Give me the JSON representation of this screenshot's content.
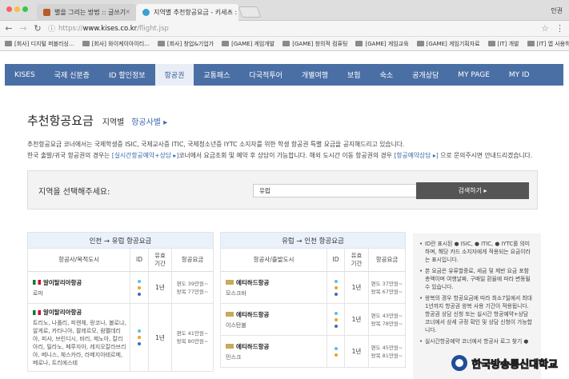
{
  "browser": {
    "tabs": [
      {
        "label": "별을 그리는 방법 :: 글쓰기",
        "close": "×"
      },
      {
        "label": "지역별 추천항공요금 - 키세스 : 학생",
        "close": "×"
      }
    ],
    "user": "인권",
    "url_prefix": "https://",
    "url_host": "www.kises.co.kr",
    "url_path": "/flight.jsp",
    "bookmarks": [
      "[회사] 디지털 퍼블리싱...",
      "[회사] 와이케이아이티...",
      "[회사] 창업&기업가",
      "[GAME] 게임개발",
      "[GAME] 창의적 컴퓨팅",
      "[GAME] 게임교육",
      "[GAME] 게임기획자료",
      "[IT] 개발",
      "[IT] 앱 사용하기"
    ]
  },
  "gnb": [
    "KISES",
    "국제 신분증",
    "ID 할인정보",
    "항공권",
    "교통패스",
    "다국적투어",
    "개별여행",
    "보험",
    "숙소",
    "공개상담",
    "MY PAGE",
    "MY ID"
  ],
  "gnb_active_index": 3,
  "page": {
    "title": "추천항공요금",
    "sub1": "지역별",
    "sub2": "항공사별 ▸",
    "desc_line1": "추천항공요금 코너에서는 국제학생증 ISIC, 국제교사증 ITIC, 국제청소년증 IYTC 소지자를 위한 학생 항공권 특별 요금을 공지해드리고 있습니다.",
    "desc_line2_a": "한국 출발/귀국 항공권의 경우는 ",
    "desc_line2_link1": "[실시간항공예약+상담 ▸]",
    "desc_line2_b": "코너에서 요금조회 및 예약 후 상담이 가능합니다. 해외 도시간 이동 항공권의 경우 ",
    "desc_line2_link2": "[항공예약상담 ▸]",
    "desc_line2_c": " 으로 문의주시면 안내드리겠습니다."
  },
  "region": {
    "label": "지역을 선택해주세요:",
    "selected": "유럽",
    "arrow": "▴▾",
    "search": "검색하기 ▸"
  },
  "left_panel": {
    "header": "인천 → 유럽 항공요금",
    "columns": [
      "항공사/목적도시",
      "ID",
      "유효\n기간",
      "항공요금"
    ],
    "rows": [
      {
        "airline": "알이탈리아항공",
        "city": "로마",
        "ids": [
          "#5bc0de",
          "#f0a020",
          "#3f6db3"
        ],
        "validity": "1년",
        "price1": "편도 39만원~",
        "price2": "왕복 77만원~"
      },
      {
        "airline": "알이탈리아항공",
        "city": "트리노, 나폴리, 피렌체, 랑코나, 볼로냐, 알게로, 카타니아, 팔레르모, 람펠데리아, 피사, 브린디시, 바리, 제노아, 칼리아리, 밀라노, 페루자아, 레지오칼라브리아, 베니스, 체스카라, 라메지아테르메, 베로나, 트리에스테",
        "ids": [
          "#5bc0de",
          "#f0a020",
          "#3f6db3"
        ],
        "validity": "1년",
        "price1": "편도 41만원~",
        "price2": "왕복 80만원~"
      }
    ]
  },
  "right_panel": {
    "header": "유럽 → 인천 항공요금",
    "columns": [
      "항공사/출발도시",
      "ID",
      "유효\n기간",
      "항공요금"
    ],
    "rows": [
      {
        "airline": "에티하드항공",
        "city": "모스크바",
        "ids": [
          "#5bc0de",
          "#f0a020",
          "#3f6db3"
        ],
        "validity": "1년",
        "price1": "편도 37만원~",
        "price2": "왕복 67만원~"
      },
      {
        "airline": "에티하드항공",
        "city": "이스탄불",
        "ids": [
          "#5bc0de",
          "#f0a020",
          "#3f6db3"
        ],
        "validity": "1년",
        "price1": "편도 43만원~",
        "price2": "왕복 78만원~"
      },
      {
        "airline": "에티하드항공",
        "city": "민스크",
        "ids": [
          "#5bc0de",
          "#f0a020"
        ],
        "validity": "1년",
        "price1": "편도 45만원~",
        "price2": "왕복 81만원~"
      }
    ]
  },
  "notes": [
    "ID란 표시된 ● ISIC, ● ITIC, ● IYTC를 의미하며, 해당 카드 소지자에게 적용되는 요금이라는 표시입니다.",
    "본 요금은 유류할증료, 세금 및 제반 요금 포함 총액이며 여행날짜, 구매일 환율에 따라 변동될 수 있습니다.",
    "왕복의 경우 항공요금에 따라 최소7일에서 최대1년까지 항공권 왕복 사용 기간이 적용됩니다. 항공권 상담 신청 또는 실시간 항공예약+상담 코너에서 상세 규정 확인 및 상담 신청이 가능합니다.",
    "실시간항공예약 코너에서 항공사 로그 찾기 ●"
  ],
  "watermark": "한국방송통신대학교",
  "colors": {
    "gnb": "#4a6fa5",
    "accent": "#3d69ad",
    "search_btn": "#555555",
    "isic": "#5bc0de",
    "itic": "#f0a020",
    "iytc": "#3f6db3"
  }
}
